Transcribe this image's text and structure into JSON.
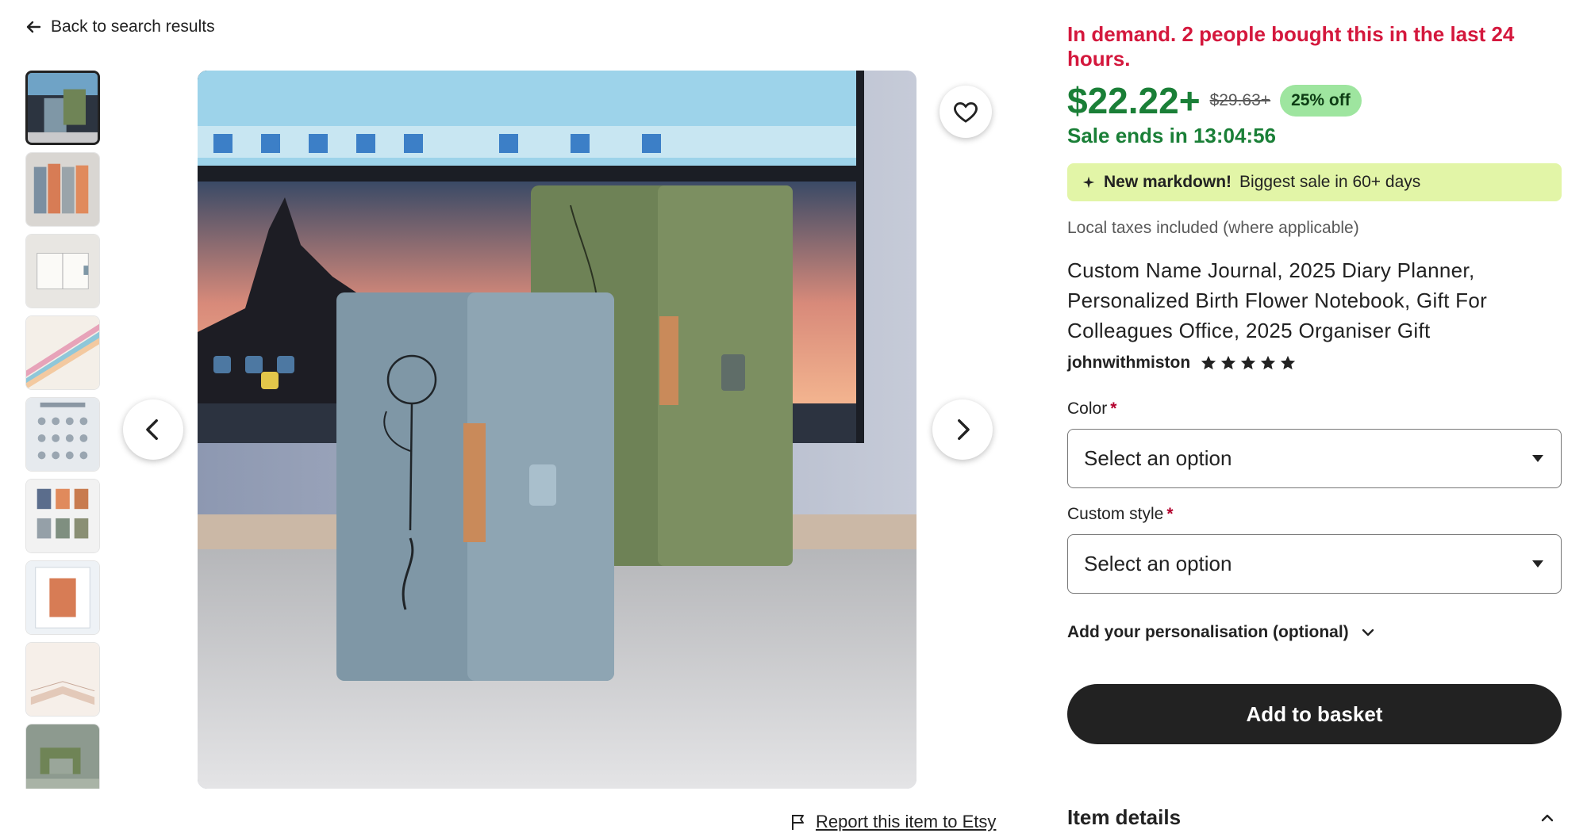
{
  "nav": {
    "back_label": "Back to search results"
  },
  "gallery": {
    "thumbnail_count": 9,
    "active_index": 0,
    "report_label": "Report this item to Etsy"
  },
  "listing": {
    "demand_text": "In demand. 2 people bought this in the last 24 hours.",
    "price": "$22.22+",
    "original_price": "$29.63+",
    "discount": "25% off",
    "sale_ends": "Sale ends in 13:04:56",
    "markdown_bold": "New markdown!",
    "markdown_text": "Biggest sale in 60+ days",
    "taxes": "Local taxes included (where applicable)",
    "title": "Custom Name Journal, 2025 Diary Planner, Personalized Birth Flower Notebook, Gift For Colleagues Office, 2025 Organiser Gift",
    "seller": "johnwithmiston",
    "rating_stars": 5
  },
  "options": {
    "color_label": "Color",
    "color_value": "Select an option",
    "style_label": "Custom style",
    "style_value": "Select an option",
    "required_mark": "*"
  },
  "actions": {
    "personalisation_label": "Add your personalisation (optional)",
    "add_to_basket": "Add to basket",
    "item_details": "Item details"
  },
  "colors": {
    "demand_red": "#d4183d",
    "price_green": "#1a7f37",
    "discount_bg": "#9ee59f",
    "markdown_bg": "#e2f5a7",
    "button_dark": "#222222"
  }
}
